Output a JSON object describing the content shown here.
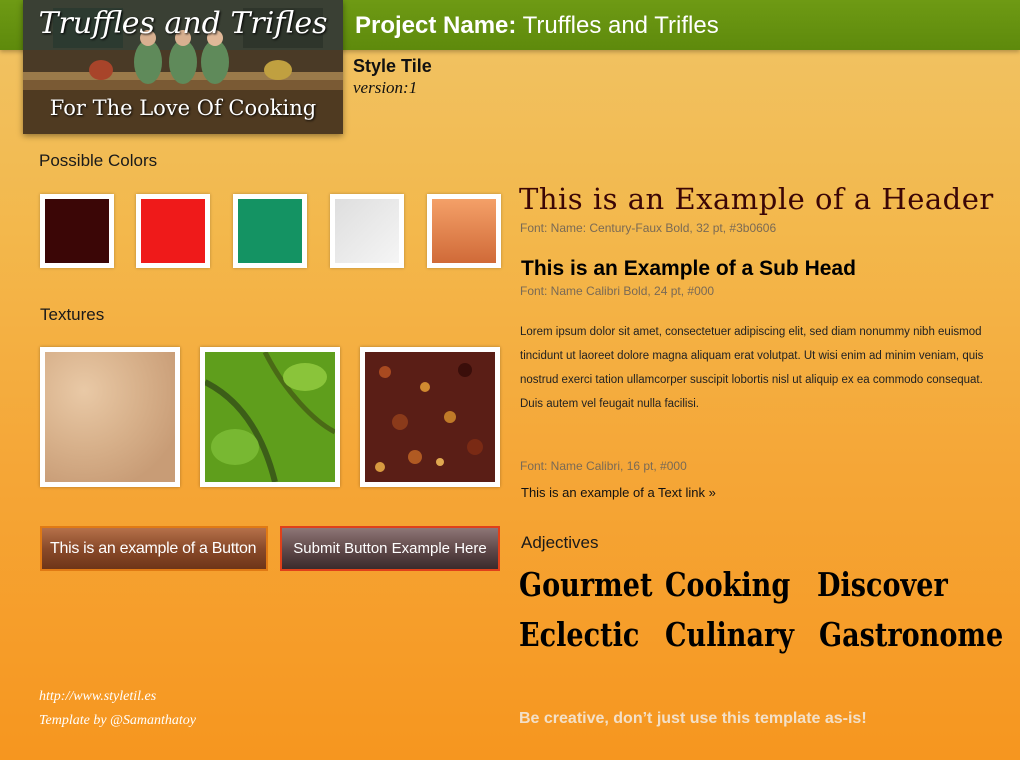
{
  "header": {
    "project_label": "Project Name:",
    "project_name": "Truffles and Trifles",
    "style_tile": "Style Tile",
    "version": "version:1"
  },
  "logo": {
    "title": "Truffles and Trifles",
    "tagline": "For The Love Of Cooking"
  },
  "colors_section": {
    "title": "Possible Colors",
    "swatches": [
      "#3b0606",
      "#ef1a1a",
      "#149363",
      "#ededed",
      "#f08c50"
    ]
  },
  "textures_section": {
    "title": "Textures",
    "items": [
      "sand-texture",
      "leaf-texture",
      "spice-texture"
    ]
  },
  "buttons": {
    "primary_label": "This is an example of a Button",
    "submit_label": "Submit Button Example Here"
  },
  "typography": {
    "header_example": "This is an Example of a Header",
    "header_caption": "Font: Name: Century-Faux Bold, 32 pt, #3b0606",
    "subhead_example": "This is an Example of a Sub Head",
    "subhead_caption": "Font: Name Calibri Bold, 24 pt, #000",
    "body_text": "Lorem ipsum dolor sit amet, consectetuer adipiscing elit, sed diam nonummy nibh euismod tincidunt ut laoreet dolore magna aliquam erat volutpat. Ut wisi enim ad minim veniam, quis nostrud exerci tation ullamcorper suscipit lobortis nisl ut aliquip ex ea commodo consequat. Duis autem vel feugait nulla facilisi.",
    "body_caption": "Font: Name Calibri, 16 pt, #000",
    "text_link": "This is an example of a Text link »"
  },
  "adjectives": {
    "title": "Adjectives",
    "words": [
      "Gourmet",
      "Cooking",
      "Discover",
      "Eclectic",
      "Culinary",
      "Gastronome"
    ]
  },
  "footer": {
    "url": "http://www.styletil.es",
    "credit": "Template by @Samanthatoy",
    "note": "Be creative, don’t just use this template as-is!"
  },
  "colors": {
    "topbar": "#5e8a0c",
    "header_color": "#3b0606"
  }
}
